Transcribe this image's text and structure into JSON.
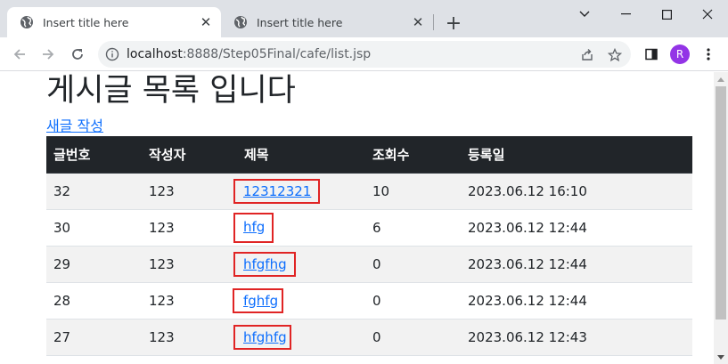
{
  "browser": {
    "tabs": [
      {
        "title": "Insert title here",
        "active": true,
        "icon": "globe-icon"
      },
      {
        "title": "Insert title here",
        "active": false,
        "icon": "globe-icon"
      }
    ],
    "new_tab_glyph": "+",
    "url_host": "localhost",
    "url_rest": ":8888/Step05Final/cafe/list.jsp",
    "profile_initial": "R",
    "profile_color": "#9334e6"
  },
  "page": {
    "title": "게시글 목록 입니다",
    "new_post_link": "새글 작성",
    "columns": [
      "글번호",
      "작성자",
      "제목",
      "조회수",
      "등록일"
    ],
    "rows": [
      {
        "num": "32",
        "writer": "123",
        "title": "12312321",
        "views": "10",
        "date": "2023.06.12 16:10"
      },
      {
        "num": "30",
        "writer": "123",
        "title": "hfg",
        "views": "6",
        "date": "2023.06.12 12:44"
      },
      {
        "num": "29",
        "writer": "123",
        "title": "hfgfhg",
        "views": "0",
        "date": "2023.06.12 12:44"
      },
      {
        "num": "28",
        "writer": "123",
        "title": "fghfg",
        "views": "0",
        "date": "2023.06.12 12:44"
      },
      {
        "num": "27",
        "writer": "123",
        "title": "hfghfg",
        "views": "0",
        "date": "2023.06.12 12:43"
      }
    ]
  },
  "colors": {
    "table_header_bg": "#212529",
    "link": "#0d6efd",
    "highlight_box": "#e02424"
  }
}
